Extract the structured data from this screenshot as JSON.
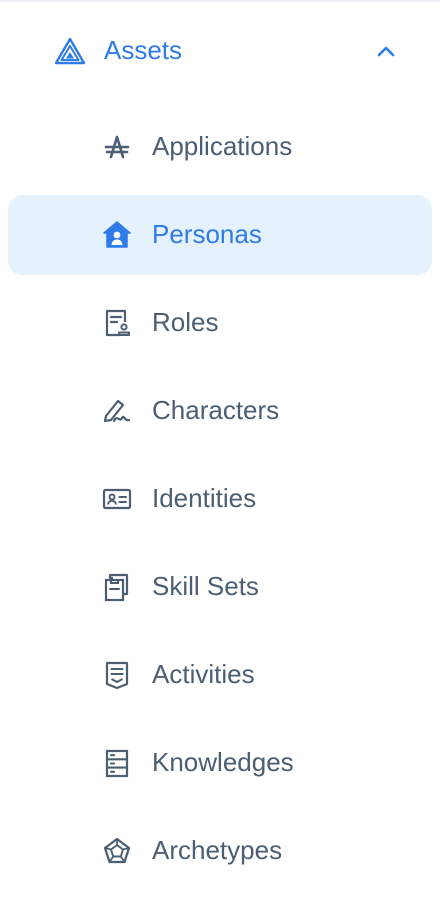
{
  "section": {
    "title": "Assets",
    "expanded": true,
    "icon": "triangle-layers-icon",
    "toggle_icon": "chevron-up-icon"
  },
  "colors": {
    "accent": "#2f7be8",
    "text": "#4b5e73",
    "active_bg": "#e5f2fd"
  },
  "items": [
    {
      "label": "Applications",
      "icon": "app-store-icon",
      "active": false
    },
    {
      "label": "Personas",
      "icon": "home-user-icon",
      "active": true
    },
    {
      "label": "Roles",
      "icon": "badge-document-icon",
      "active": false
    },
    {
      "label": "Characters",
      "icon": "signature-pen-icon",
      "active": false
    },
    {
      "label": "Identities",
      "icon": "id-card-icon",
      "active": false
    },
    {
      "label": "Skill Sets",
      "icon": "clipboard-copy-icon",
      "active": false
    },
    {
      "label": "Activities",
      "icon": "document-list-icon",
      "active": false
    },
    {
      "label": "Knowledges",
      "icon": "server-list-icon",
      "active": false
    },
    {
      "label": "Archetypes",
      "icon": "pentagon-web-icon",
      "active": false
    }
  ]
}
